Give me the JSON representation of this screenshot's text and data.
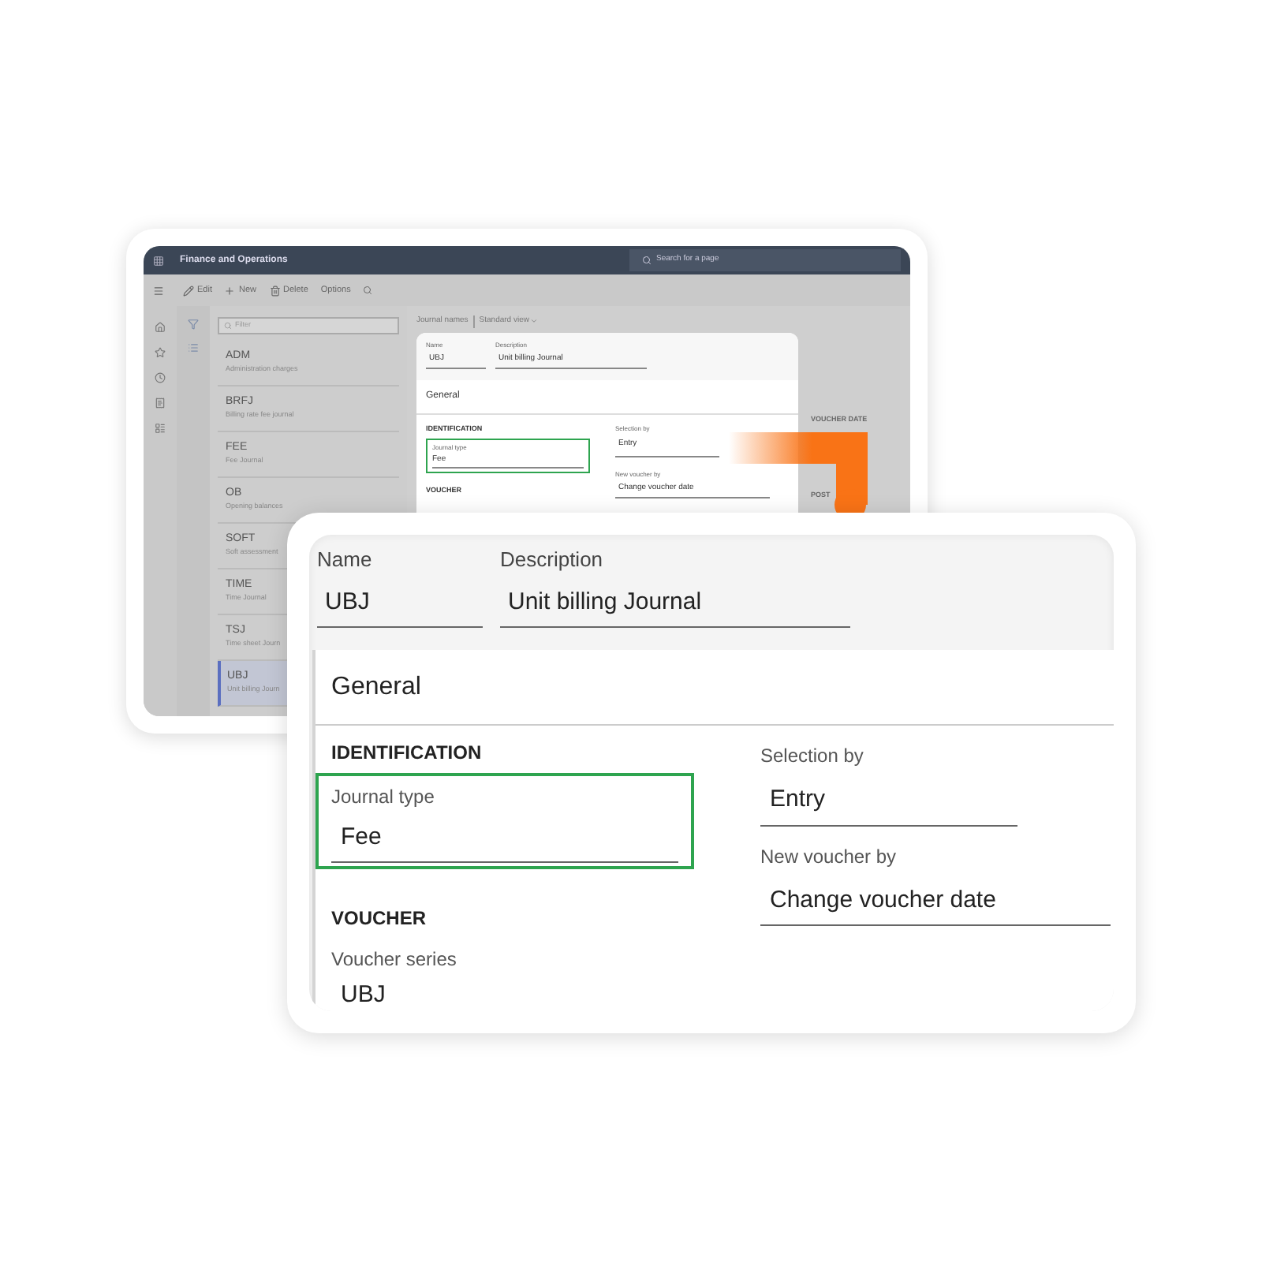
{
  "background_window": {
    "app_title": "Finance and Operations",
    "search": {
      "placeholder": "Search for a page"
    },
    "toolbar": [
      {
        "label": "Edit",
        "kind": "edit"
      },
      {
        "label": "New",
        "kind": "new"
      },
      {
        "label": "Delete",
        "kind": "delete"
      },
      {
        "label": "Options",
        "kind": "text"
      }
    ],
    "filter": {
      "placeholder": "Filter"
    },
    "list": [
      {
        "code": "ADM",
        "description": "Administration charges",
        "selected": false
      },
      {
        "code": "BRFJ",
        "description": "Billing rate fee journal",
        "selected": false
      },
      {
        "code": "FEE",
        "description": "Fee Journal",
        "selected": false
      },
      {
        "code": "OB",
        "description": "Opening balances",
        "selected": false
      },
      {
        "code": "SOFT",
        "description": "Soft assessment",
        "selected": false
      },
      {
        "code": "TIME",
        "description": "Time Journal",
        "selected": false
      },
      {
        "code": "TSJ",
        "description": "Time sheet Journ",
        "selected": false
      },
      {
        "code": "UBJ",
        "description": "Unit billing Journ",
        "selected": true
      }
    ],
    "breadcrumb": {
      "title": "Journal names",
      "view": "Standard view"
    },
    "form": {
      "name": {
        "label": "Name",
        "value": "UBJ"
      },
      "description": {
        "label": "Description",
        "value": "Unit billing Journal"
      },
      "section": "General",
      "identification": "IDENTIFICATION",
      "journal_type": {
        "label": "Journal type",
        "value": "Fee",
        "highlighted": true
      },
      "selection_by": {
        "label": "Selection by",
        "value": "Entry"
      },
      "new_voucher_by": {
        "label": "New voucher by",
        "value": "Change voucher date"
      },
      "voucher": "VOUCHER"
    },
    "right_panel": {
      "heading": "VOUCHER DATE",
      "heading_2": "POST"
    }
  },
  "detail_panel": {
    "name": {
      "label": "Name",
      "value": "UBJ"
    },
    "description": {
      "label": "Description",
      "value": "Unit billing Journal"
    },
    "section": "General",
    "identification": "IDENTIFICATION",
    "journal_type": {
      "label": "Journal type",
      "value": "Fee",
      "highlighted": true
    },
    "selection_by": {
      "label": "Selection by",
      "value": "Entry"
    },
    "new_voucher_by": {
      "label": "New voucher by",
      "value": "Change voucher date"
    },
    "voucher": "VOUCHER",
    "voucher_series": {
      "label": "Voucher series",
      "value": "UBJ"
    }
  }
}
